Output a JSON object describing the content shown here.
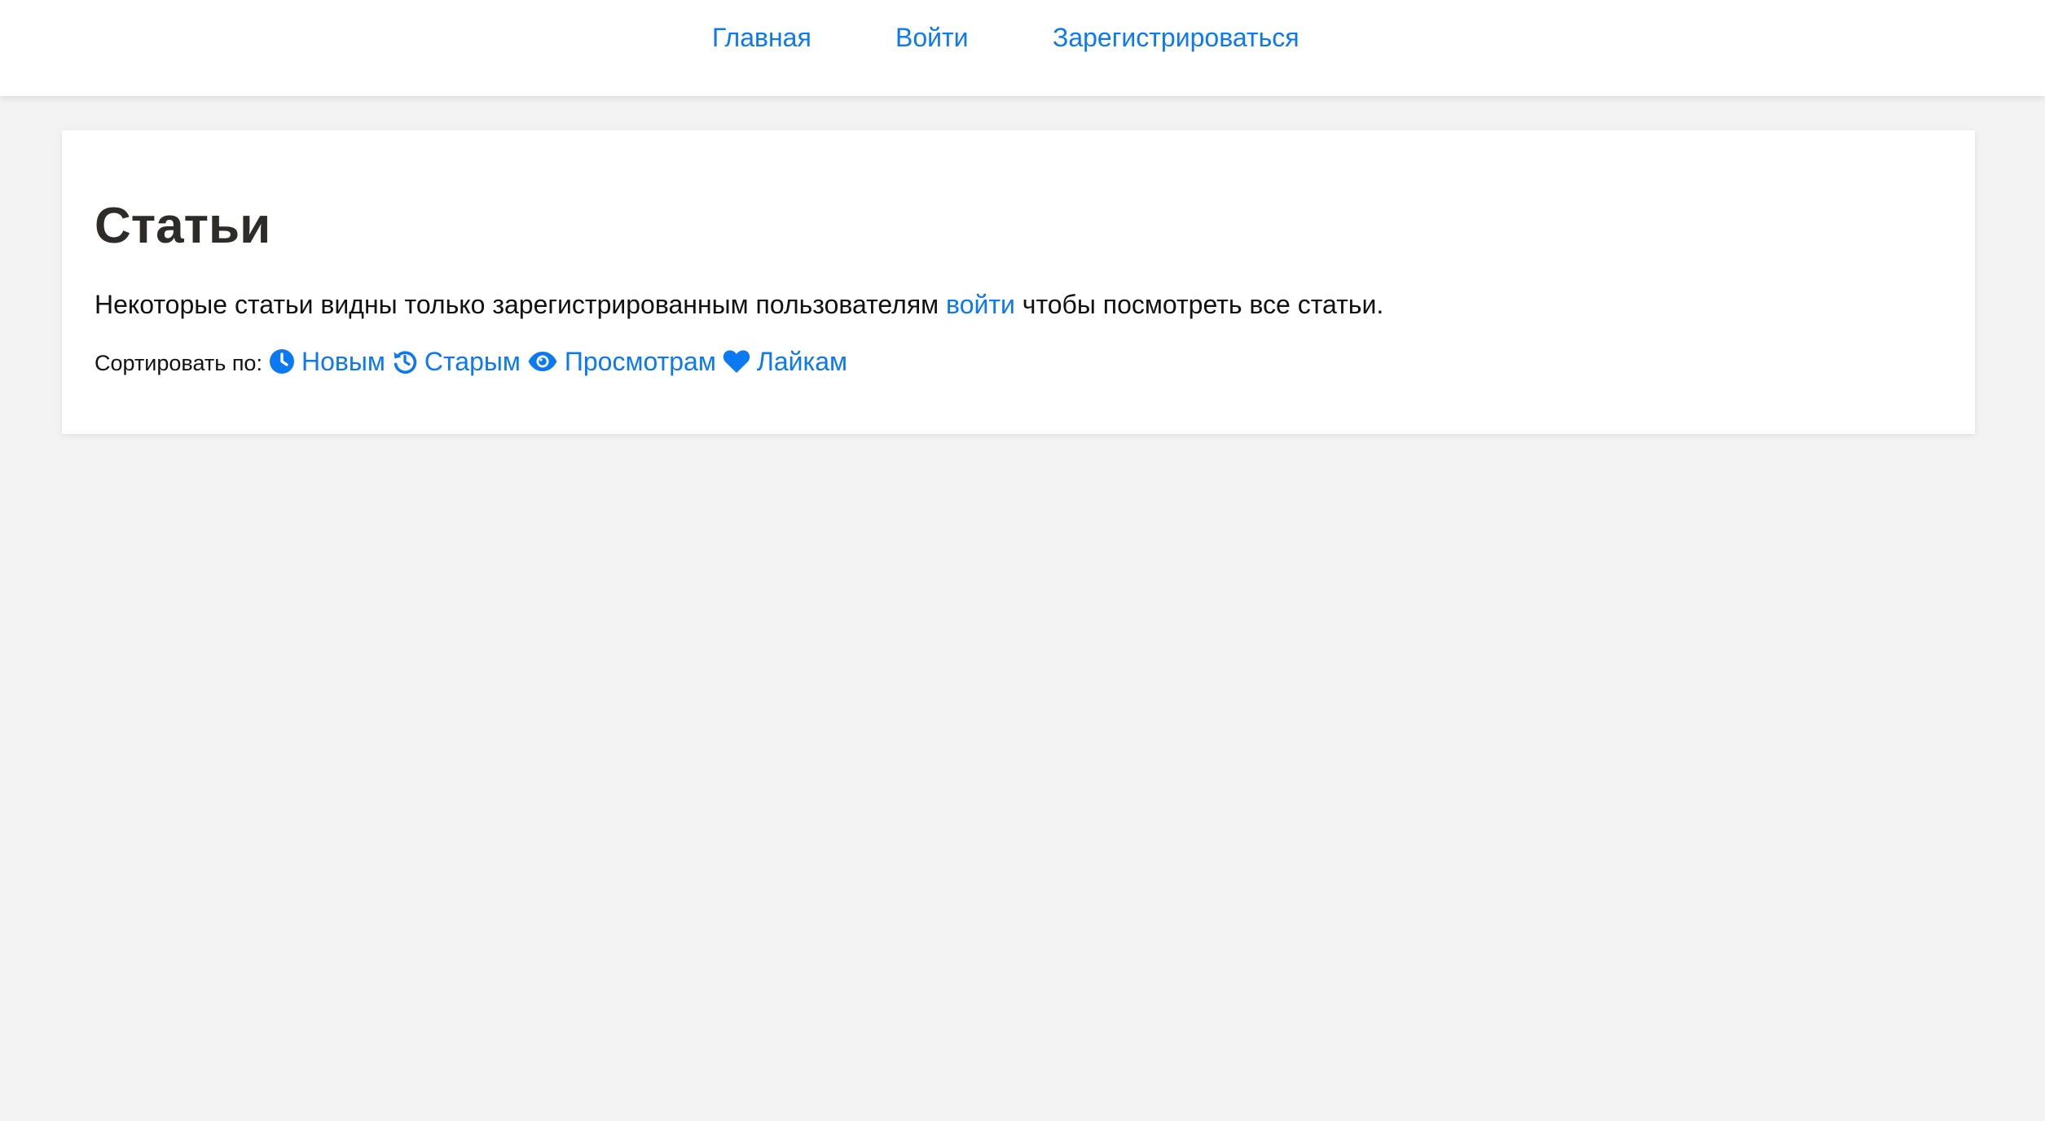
{
  "nav": {
    "items": [
      {
        "label": "Главная"
      },
      {
        "label": "Войти"
      },
      {
        "label": "Зарегистрироваться"
      }
    ]
  },
  "main": {
    "title": "Статьи",
    "notice_before": "Некоторые статьи видны только зарегистрированным пользователям ",
    "notice_link": "войти",
    "notice_after": " чтобы посмотреть все статьи.",
    "sort_label": "Сортировать по:",
    "sort_options": [
      {
        "label": "Новым",
        "icon": "clock-icon"
      },
      {
        "label": "Старым",
        "icon": "history-icon"
      },
      {
        "label": "Просмотрам",
        "icon": "eye-icon"
      },
      {
        "label": "Лайкам",
        "icon": "heart-icon"
      }
    ]
  },
  "colors": {
    "link": "#0b79f2",
    "background": "#f3f3f3",
    "card": "#ffffff",
    "title": "#2e2b29"
  }
}
